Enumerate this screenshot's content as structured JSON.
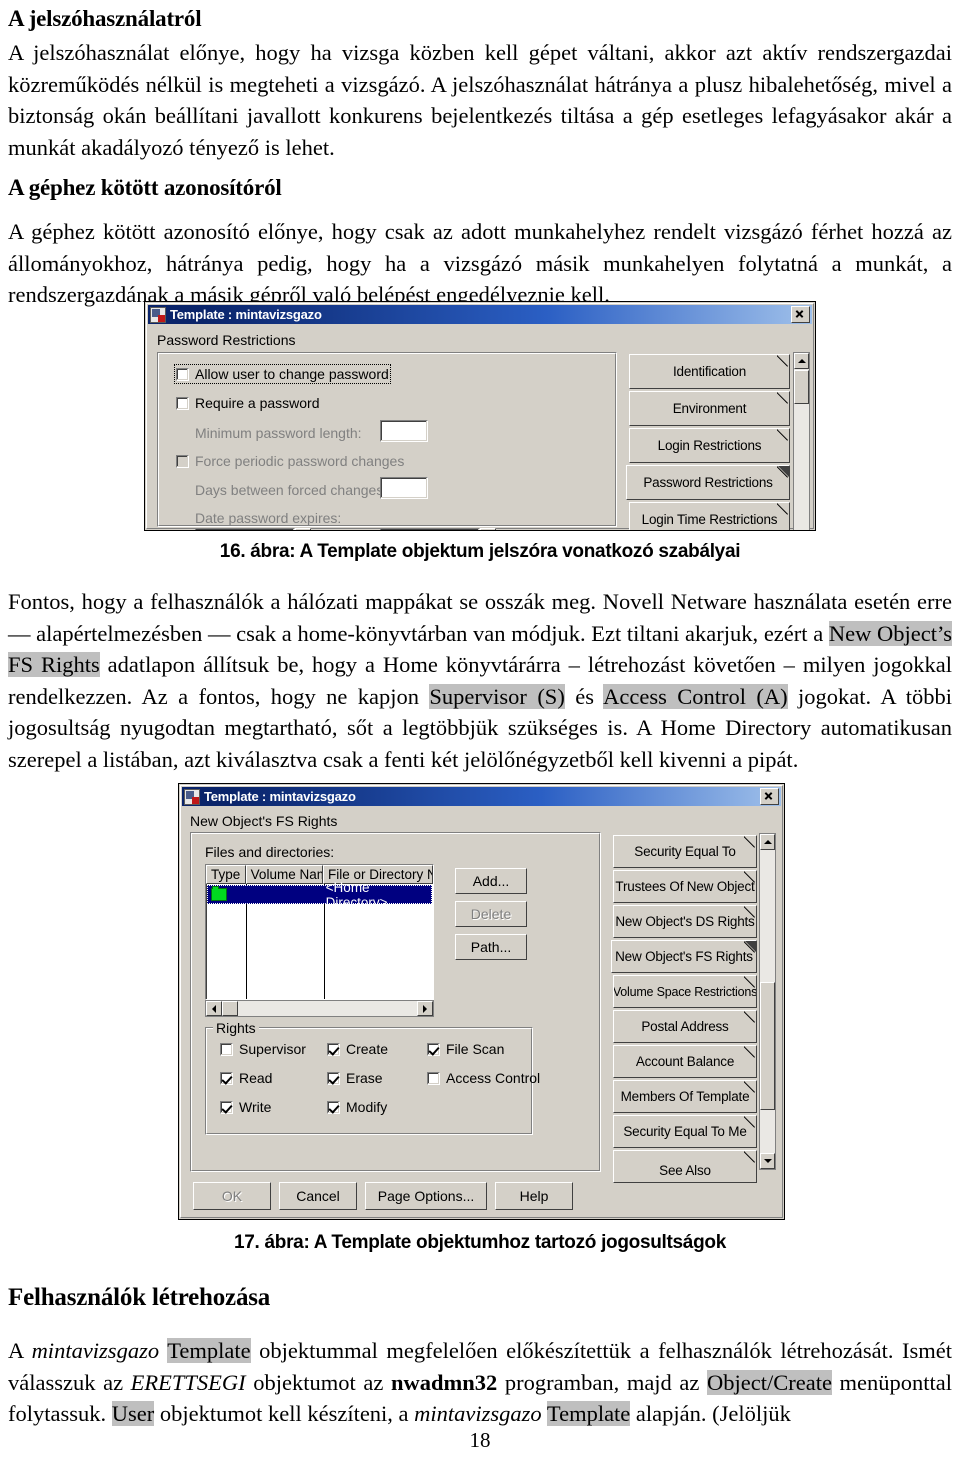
{
  "page": {
    "number": "18"
  },
  "sections": {
    "heading1": "A jelszóhasználatról",
    "para1_a": "A jelszóhasználat előnye, hogy ha vizsga közben kell gépet váltani, akkor azt aktív rendszergazdai közreműködés nélkül is megteheti a vizsgázó. ",
    "para1_b": "A jelszóhasználat hátránya a plusz hibalehetőség, mivel a biztonság okán beállítani javallott konkurens bejelentkezés tiltása a gép esetleges lefagyásakor akár a munkát akadályozó tényező is lehet.",
    "heading2": "A géphez kötött azonosítóról",
    "para2": "A géphez kötött azonosító előnye, hogy csak az adott munkahelyhez rendelt vizsgázó férhet hozzá az állományokhoz, hátránya pedig, hogy ha a vizsgázó másik munkahelyen folytatná a munkát, a rendszergazdának a másik gépről való belépést engedélyeznie kell.",
    "caption16": "16. ábra: A Template objektum jelszóra vonatkozó szabályai",
    "para3": {
      "t1": "Fontos, hogy a felhasználók a hálózati mappákat se osszák meg. Novell Netware használata esetén erre — alapértelmezésben — csak a home-könyvtárban van módjuk. Ezt tiltani akarjuk, ezért a ",
      "h1": "New Object",
      "h1b": "’s FS Rights",
      "t2": " adatlapon állítsuk be, hogy a Home könyvtárárra – létrehozást követően – milyen jogokkal rendelkezzen. Az a fontos, hogy ne kapjon ",
      "h2": "Supervisor (S)",
      "t3": " és ",
      "h3": "Access Control (A)",
      "t4": " jogokat. A többi jogosultság nyugodtan megtartható, sőt a legtöbbjük szükséges is. A Home Directory automatikusan szerepel a listában, azt kiválasztva csak a fenti két jelölőnégyzetből kell kivenni a pipát."
    },
    "caption17": "17. ábra: A Template objektumhoz tartozó jogosultságok",
    "heading3": "Felhasználók létrehozása",
    "para4": {
      "t1": "A ",
      "i1": "mintavizsgazo",
      "t2": " ",
      "h1": "Template",
      "t3": " objektummal megfelelően előkészítettük a felhasználók létrehozását. Ismét válasszuk az ",
      "i2": "ERETTSEGI",
      "t4": " objektumot az ",
      "b1": "nwadmn32",
      "t5": " programban, majd az ",
      "h2": "Object/Create",
      "t6": " menüponttal folytassuk. ",
      "h3": "User",
      "t7": " objektumot kell készíteni, a ",
      "i3": "mintavizsgazo",
      "t8": " ",
      "h4": "Template",
      "t9": " alapján. (Jelöljük"
    }
  },
  "dialog16": {
    "title": "Template : mintavizsgazo",
    "close_label": "X",
    "page_label": "Password Restrictions",
    "checkboxes": [
      {
        "label": "Allow user to change password",
        "checked": false,
        "disabled": false,
        "focused": true
      },
      {
        "label": "Require a password",
        "checked": false,
        "disabled": false,
        "focused": false
      },
      {
        "label": "Force periodic password changes",
        "checked": false,
        "disabled": true,
        "focused": false
      }
    ],
    "fields": [
      {
        "label": "Minimum password length:",
        "value": "",
        "disabled": true
      },
      {
        "label": "Days between forced changes:",
        "value": "",
        "disabled": true
      },
      {
        "label": "Date password expires:",
        "value": "",
        "disabled": true
      }
    ],
    "tabs": [
      {
        "label": "Identification",
        "selected": false
      },
      {
        "label": "Environment",
        "selected": false
      },
      {
        "label": "Login Restrictions",
        "selected": false
      },
      {
        "label": "Password Restrictions",
        "selected": true
      },
      {
        "label": "Login Time Restrictions",
        "selected": false
      }
    ]
  },
  "dialog17": {
    "title": "Template : mintavizsgazo",
    "close_label": "X",
    "page_label": "New Object's FS Rights",
    "list_label": "Files and directories:",
    "columns": [
      "Type",
      "Volume Name",
      "File or Directory Name"
    ],
    "rows": [
      {
        "type_icon": "folder-icon",
        "volume": "",
        "name": "<Home Directory>",
        "selected": true
      }
    ],
    "side_buttons": [
      {
        "label": "Add...",
        "disabled": false
      },
      {
        "label": "Delete",
        "disabled": true
      },
      {
        "label": "Path...",
        "disabled": false
      }
    ],
    "rights_group": "Rights",
    "rights": [
      {
        "label": "Supervisor",
        "checked": false
      },
      {
        "label": "Create",
        "checked": true
      },
      {
        "label": "File Scan",
        "checked": true
      },
      {
        "label": "Read",
        "checked": true
      },
      {
        "label": "Erase",
        "checked": true
      },
      {
        "label": "Access Control",
        "checked": false
      },
      {
        "label": "Write",
        "checked": true
      },
      {
        "label": "Modify",
        "checked": true
      }
    ],
    "tabs": [
      {
        "label": "Security Equal To",
        "selected": false
      },
      {
        "label": "Trustees Of New Object",
        "selected": false
      },
      {
        "label": "New Object's DS Rights",
        "selected": false
      },
      {
        "label": "New Object's FS Rights",
        "selected": true
      },
      {
        "label": "Volume Space Restrictions",
        "selected": false
      },
      {
        "label": "Postal Address",
        "selected": false
      },
      {
        "label": "Account Balance",
        "selected": false
      },
      {
        "label": "Members Of Template",
        "selected": false
      },
      {
        "label": "Security Equal To Me",
        "selected": false
      },
      {
        "label": "See Also",
        "selected": false
      }
    ],
    "bottom_buttons": [
      {
        "label": "OK",
        "disabled": true
      },
      {
        "label": "Cancel",
        "disabled": false
      },
      {
        "label": "Page Options...",
        "disabled": false
      },
      {
        "label": "Help",
        "disabled": false
      }
    ]
  }
}
